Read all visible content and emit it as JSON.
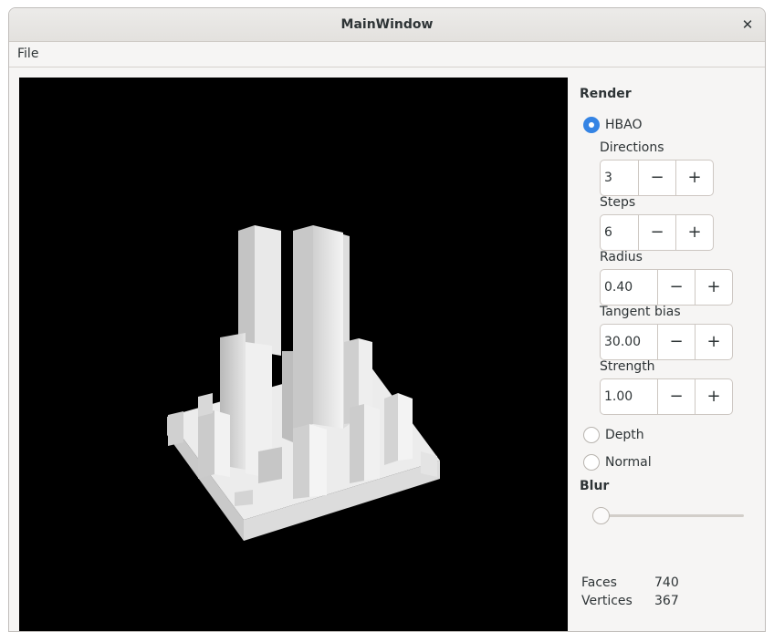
{
  "window": {
    "title": "MainWindow"
  },
  "menu": {
    "file": "File"
  },
  "render": {
    "heading": "Render",
    "hbao_label": "HBAO",
    "directions": {
      "label": "Directions",
      "value": "3"
    },
    "steps": {
      "label": "Steps",
      "value": "6"
    },
    "radius": {
      "label": "Radius",
      "value": "0.40"
    },
    "tangent_bias": {
      "label": "Tangent bias",
      "value": "30.00"
    },
    "strength": {
      "label": "Strength",
      "value": "1.00"
    },
    "depth_label": "Depth",
    "normal_label": "Normal",
    "selected_mode": "HBAO"
  },
  "blur": {
    "heading": "Blur",
    "value": 0
  },
  "stats": {
    "faces_label": "Faces",
    "faces_value": "740",
    "vertices_label": "Vertices",
    "vertices_value": "367"
  },
  "spin": {
    "minus": "−",
    "plus": "+"
  },
  "icons": {
    "close": "close-icon"
  },
  "colors": {
    "accent": "#3584e4",
    "viewport_bg": "#000000"
  }
}
